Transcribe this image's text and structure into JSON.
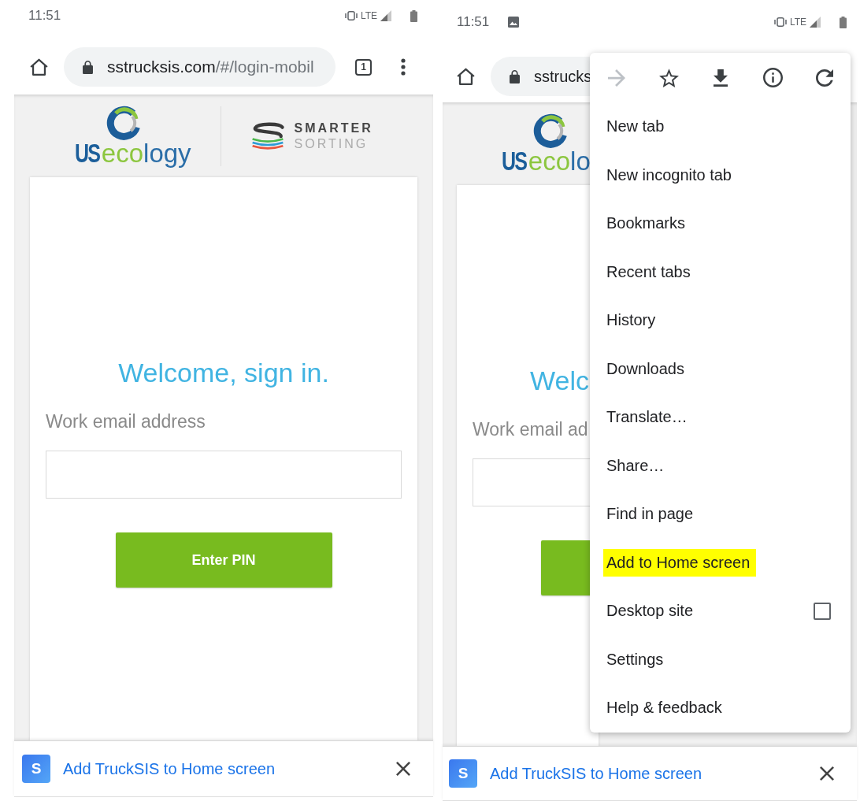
{
  "left_screen": {
    "status_bar": {
      "time": "11:51",
      "network": "LTE"
    },
    "address_bar": {
      "host": "sstrucksis.com",
      "path": "/#/login-mobil",
      "tab_count": "1"
    },
    "header": {
      "logo_mark": "US",
      "logo_name": [
        "eco",
        "logy"
      ],
      "partner_lines": [
        "SMARTER",
        "SORTING"
      ]
    },
    "login": {
      "title": "Welcome, sign in.",
      "email_label": "Work email address",
      "button": "Enter PIN"
    },
    "install_banner": {
      "icon_letter": "S",
      "text": "Add TruckSIS to Home screen"
    }
  },
  "right_screen": {
    "status_bar": {
      "time": "11:51",
      "network": "LTE"
    },
    "address_bar": {
      "host": "sstrucks"
    },
    "header": {
      "logo_mark": "US",
      "logo_name": [
        "eco",
        "lo"
      ]
    },
    "login": {
      "title": "Welc",
      "email_label": "Work email ad"
    },
    "menu": {
      "toolbar": [
        {
          "kind": "forward",
          "disabled": true
        },
        {
          "kind": "bookmark",
          "disabled": false
        },
        {
          "kind": "download",
          "disabled": false
        },
        {
          "kind": "info",
          "disabled": false
        },
        {
          "kind": "reload",
          "disabled": false
        }
      ],
      "items": [
        {
          "kind": "action",
          "label": "New tab",
          "highlighted": false
        },
        {
          "kind": "action",
          "label": "New incognito tab",
          "highlighted": false
        },
        {
          "kind": "action",
          "label": "Bookmarks",
          "highlighted": false
        },
        {
          "kind": "action",
          "label": "Recent tabs",
          "highlighted": false
        },
        {
          "kind": "action",
          "label": "History",
          "highlighted": false
        },
        {
          "kind": "action",
          "label": "Downloads",
          "highlighted": false
        },
        {
          "kind": "action",
          "label": "Translate…",
          "highlighted": false
        },
        {
          "kind": "action",
          "label": "Share…",
          "highlighted": false
        },
        {
          "kind": "action",
          "label": "Find in page",
          "highlighted": false
        },
        {
          "kind": "action",
          "label": "Add to Home screen",
          "highlighted": true
        },
        {
          "kind": "checkbox",
          "label": "Desktop site",
          "highlighted": false,
          "checked": false
        },
        {
          "kind": "action",
          "label": "Settings",
          "highlighted": false
        },
        {
          "kind": "action",
          "label": "Help & feedback",
          "highlighted": false
        }
      ]
    },
    "install_banner": {
      "icon_letter": "S",
      "text": "Add TruckSIS to Home screen"
    }
  }
}
